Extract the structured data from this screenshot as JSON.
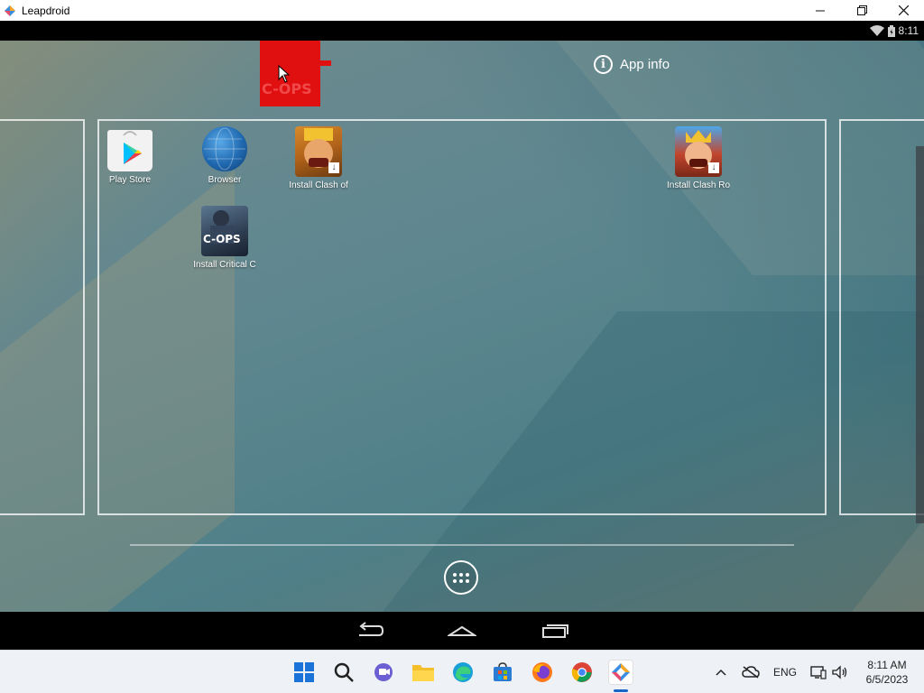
{
  "window": {
    "title": "Leapdroid"
  },
  "statusbar": {
    "time": "8:11"
  },
  "screen": {
    "app_info_label": "App info",
    "apps": [
      {
        "label": "Play Store",
        "icon": "play-store-icon"
      },
      {
        "label": "Browser",
        "icon": "browser-globe-icon"
      },
      {
        "label": "Install Clash of",
        "icon": "clash-of-clans-icon"
      },
      {
        "label": "Install Clash Ro",
        "icon": "clash-royale-icon"
      },
      {
        "label": "Install Critical C",
        "icon": "critical-ops-icon"
      }
    ],
    "icon_text": {
      "cops": "C-OPS"
    }
  },
  "taskbar": {
    "language": "ENG",
    "clock_time": "8:11 AM",
    "clock_date": "6/5/2023"
  },
  "colors": {
    "drag_highlight": "#e01010",
    "taskbar_accent": "#1a66c9"
  }
}
